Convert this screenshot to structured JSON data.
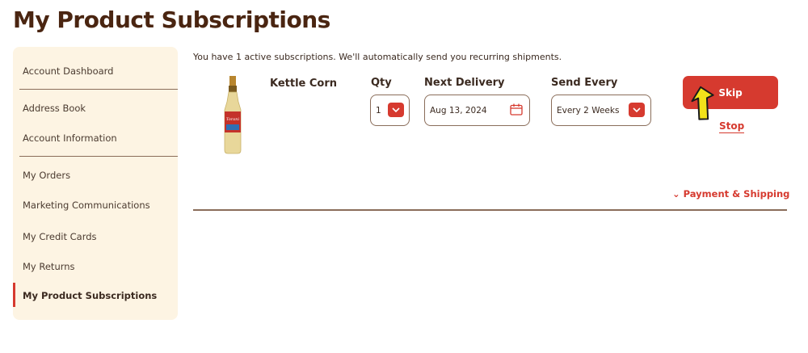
{
  "page": {
    "title": "My Product Subscriptions"
  },
  "sidebar": {
    "items": [
      {
        "label": "Account Dashboard"
      },
      {
        "label": "Address Book"
      },
      {
        "label": "Account Information"
      },
      {
        "label": "My Orders"
      },
      {
        "label": "Marketing Communications"
      },
      {
        "label": "My Credit Cards"
      },
      {
        "label": "My Returns"
      },
      {
        "label": "My Product Subscriptions",
        "active": true
      }
    ]
  },
  "subscriptions": {
    "intro": "You have 1 active subscriptions. We'll automatically send you recurring shipments.",
    "item": {
      "product_name": "Kettle Corn",
      "qty_label": "Qty",
      "qty_value": "1",
      "next_delivery_label": "Next Delivery",
      "next_delivery_value": "Aug 13, 2024",
      "send_every_label": "Send Every",
      "send_every_value": "Every 2 Weeks",
      "skip_label": "Skip",
      "stop_label": "Stop"
    },
    "payment_shipping_label": "Payment & Shipping"
  },
  "colors": {
    "accent": "#d63a2f",
    "title": "#4a2511",
    "sidebar_bg": "#fdf4e3",
    "border": "#8a6d5a"
  },
  "icons": {
    "dropdown": "chevron-down-icon",
    "calendar": "calendar-icon",
    "payment_toggle": "chevron-down-icon",
    "pointer": "arrow-pointer-icon"
  }
}
